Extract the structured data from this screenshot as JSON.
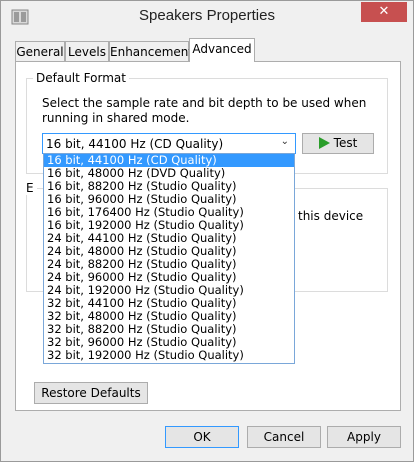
{
  "window": {
    "title": "Speakers Properties",
    "close_glyph": "✕"
  },
  "tabs": [
    {
      "label": "General"
    },
    {
      "label": "Levels"
    },
    {
      "label": "Enhancements"
    },
    {
      "label": "Advanced"
    }
  ],
  "default_format": {
    "group_label": "Default Format",
    "description": "Select the sample rate and bit depth to be used when running in shared mode.",
    "selected": "16 bit, 44100 Hz (CD Quality)",
    "arrow_glyph": "⌄",
    "test_label": "Test",
    "test_icon": "play-icon"
  },
  "dropdown_options": [
    "16 bit, 44100 Hz (CD Quality)",
    "16 bit, 48000 Hz (DVD Quality)",
    "16 bit, 88200 Hz (Studio Quality)",
    "16 bit, 96000 Hz (Studio Quality)",
    "16 bit, 176400 Hz (Studio Quality)",
    "16 bit, 192000 Hz (Studio Quality)",
    "24 bit, 44100 Hz (Studio Quality)",
    "24 bit, 48000 Hz (Studio Quality)",
    "24 bit, 88200 Hz (Studio Quality)",
    "24 bit, 96000 Hz (Studio Quality)",
    "24 bit, 192000 Hz (Studio Quality)",
    "32 bit, 44100 Hz (Studio Quality)",
    "32 bit, 48000 Hz (Studio Quality)",
    "32 bit, 88200 Hz (Studio Quality)",
    "32 bit, 96000 Hz (Studio Quality)",
    "32 bit, 192000 Hz (Studio Quality)"
  ],
  "exclusive_mode": {
    "partial_label_initial": "E",
    "partial_text": "this device"
  },
  "buttons": {
    "restore_defaults": "Restore Defaults",
    "ok": "OK",
    "cancel": "Cancel",
    "apply": "Apply"
  },
  "colors": {
    "accent": "#3399ff",
    "close_button": "#c75050",
    "play_icon": "#2a9d2a"
  }
}
